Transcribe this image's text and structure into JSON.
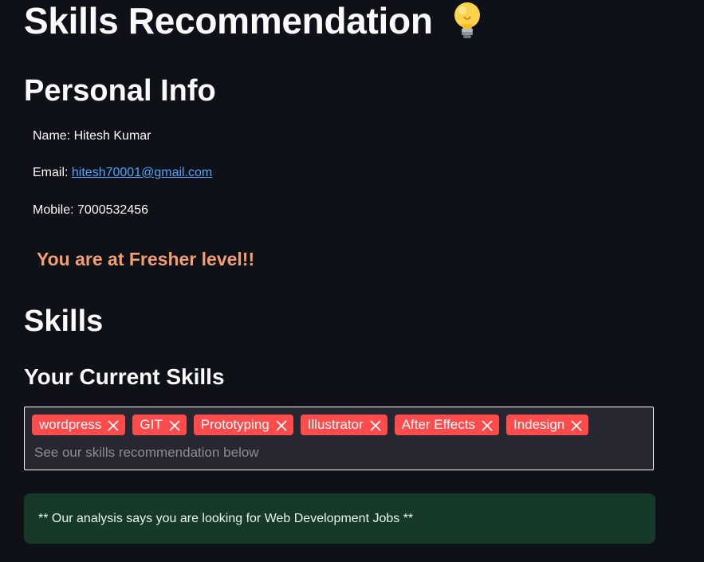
{
  "header": {
    "title": "Skills Recommendation",
    "title_icon": "lightbulb-icon"
  },
  "personal": {
    "heading": "Personal Info",
    "name_text": "Name: Hitesh Kumar",
    "email_prefix": "Email: ",
    "email": "hitesh70001@gmail.com",
    "mobile_text": "Mobile: 7000532456"
  },
  "level": {
    "text": "You are at Fresher level!!",
    "color": "#f59e70"
  },
  "skills": {
    "heading": "Skills",
    "subheading": "Your Current Skills",
    "tags": [
      "wordpress",
      "GIT",
      "Prototyping",
      "Illustrator",
      "After Effects",
      "Indesign"
    ],
    "placeholder": "See our skills recommendation below",
    "tag_color": "#ff4b4b",
    "tag_remove_icon": "close-icon"
  },
  "analysis": {
    "text": "** Our analysis says you are looking for Web Development Jobs **",
    "background": "#173928"
  }
}
